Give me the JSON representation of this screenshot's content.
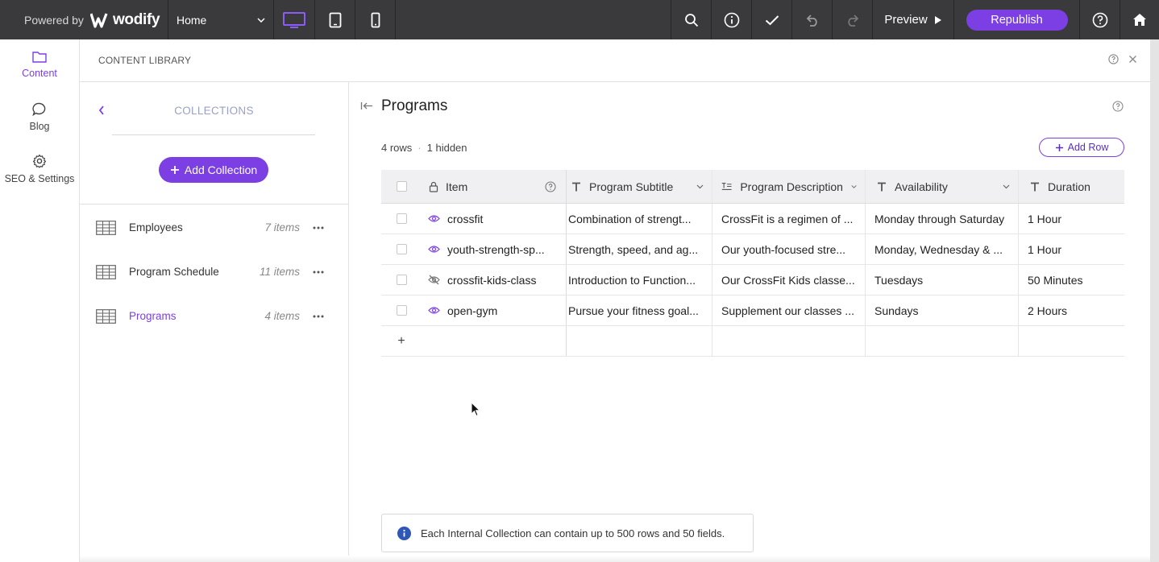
{
  "topbar": {
    "powered_by": "Powered by",
    "brand": "wodify",
    "page_select": "Home",
    "preview_label": "Preview",
    "republish_label": "Republish"
  },
  "rail": {
    "items": [
      {
        "label": "Content",
        "icon": "folder-icon"
      },
      {
        "label": "Blog",
        "icon": "chat-bubble-icon"
      },
      {
        "label": "SEO & Settings",
        "icon": "gear-icon"
      }
    ]
  },
  "panel": {
    "title": "CONTENT LIBRARY"
  },
  "collections": {
    "label": "COLLECTIONS",
    "add_label": "Add Collection",
    "items": [
      {
        "name": "Employees",
        "count": "7 items"
      },
      {
        "name": "Program Schedule",
        "count": "11 items"
      },
      {
        "name": "Programs",
        "count": "4 items"
      }
    ]
  },
  "main": {
    "title": "Programs",
    "rows_count": "4 rows",
    "hidden_count": "1 hidden",
    "add_row_label": "Add Row",
    "columns": [
      "Item",
      "Program Subtitle",
      "Program Description",
      "Availability",
      "Duration"
    ],
    "rows": [
      {
        "item": "crossfit",
        "visible": true,
        "subtitle": "Combination of strengt...",
        "description": "CrossFit is a regimen of ...",
        "availability": "Monday through Saturday",
        "duration": "1 Hour"
      },
      {
        "item": "youth-strength-sp...",
        "visible": true,
        "subtitle": "Strength, speed, and ag...",
        "description": "Our youth-focused stre...",
        "availability": "Monday, Wednesday & ...",
        "duration": "1 Hour"
      },
      {
        "item": "crossfit-kids-class",
        "visible": false,
        "subtitle": "Introduction to Function...",
        "description": "Our CrossFit Kids classe...",
        "availability": "Tuesdays",
        "duration": "50 Minutes"
      },
      {
        "item": "open-gym",
        "visible": true,
        "subtitle": "Pursue your fitness goal...",
        "description": "Supplement our classes ...",
        "availability": "Sundays",
        "duration": "2 Hours"
      }
    ],
    "add_row_plus": "+",
    "info_text": "Each Internal Collection can contain up to 500 rows and 50 fields."
  },
  "colors": {
    "accent": "#7b3fe4",
    "topbar": "#3a3a3c"
  }
}
